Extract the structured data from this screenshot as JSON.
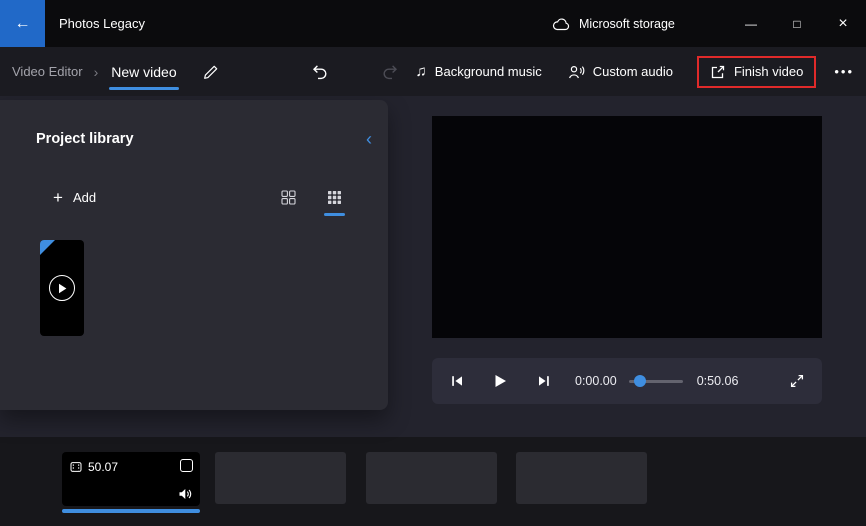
{
  "colors": {
    "accent": "#3f8ee0",
    "annotation": "#e02a2a",
    "back_button": "#2169c8"
  },
  "icons": {
    "back": "←",
    "separator": "›",
    "collapse": "‹",
    "plus": "+",
    "music_note": "♫"
  },
  "titlebar": {
    "title": "Photos Legacy",
    "storage_label": "Microsoft storage",
    "minimize": "—",
    "maximize": "□",
    "close": "×"
  },
  "toolbar": {
    "breadcrumb": "Video Editor",
    "tab": "New video",
    "background_music": "Background music",
    "custom_audio": "Custom audio",
    "finish_video": "Finish video",
    "more": "•••"
  },
  "library": {
    "title": "Project library",
    "add": "Add"
  },
  "player": {
    "current_time": "0:00.00",
    "duration": "0:50.06"
  },
  "timeline": {
    "clip_duration": "50.07"
  }
}
